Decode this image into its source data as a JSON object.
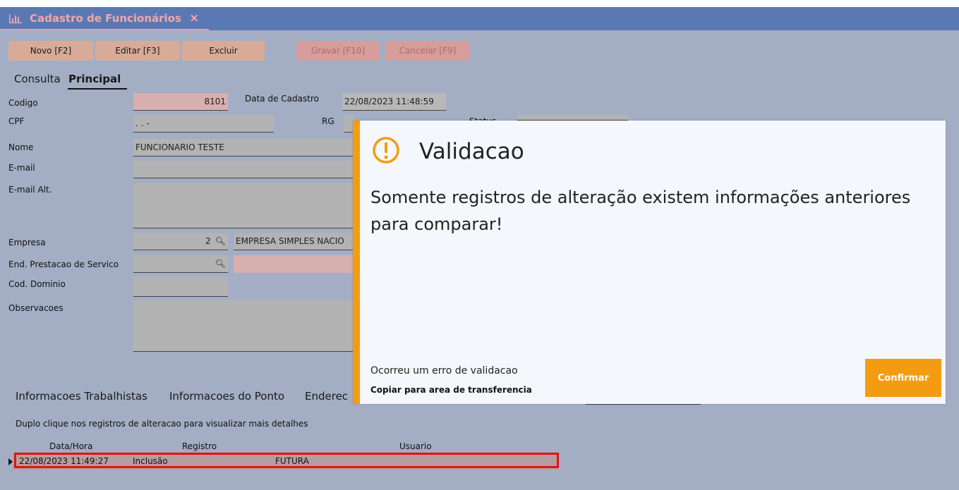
{
  "window": {
    "tab_title": "Cadastro de Funcionários",
    "close_glyph": "✕"
  },
  "toolbar": {
    "novo": "Novo [F2]",
    "editar": "Editar [F3]",
    "excluir": "Excluir",
    "gravar": "Gravar [F10]",
    "cancelar": "Cancelar [F9]"
  },
  "subtabs": {
    "consulta": "Consulta",
    "principal": "Principal"
  },
  "form": {
    "codigo_label": "Codigo",
    "codigo_value": "8101",
    "data_cadastro_label": "Data de Cadastro",
    "data_cadastro_value": "22/08/2023 11:48:59",
    "cpf_label": "CPF",
    "cpf_value": " .  .  -",
    "rg_label": "RG",
    "status_label": "Status",
    "nome_label": "Nome",
    "nome_value": "FUNCIONARIO TESTE",
    "email_label": "E-mail",
    "email_alt_label": "E-mail Alt.",
    "empresa_label": "Empresa",
    "empresa_code": "2",
    "empresa_name": "EMPRESA SIMPLES NACIO",
    "end_prest_label": "End. Prestacao de Servico",
    "cod_dominio_label": "Cod. Dominio",
    "observacoes_label": "Observacoes"
  },
  "bottom_tabs": [
    "Informacoes Trabalhistas",
    "Informacoes do Ponto",
    "Enderec"
  ],
  "history": {
    "hint": "Duplo clique nos registros de alteracao para visualizar mais detalhes",
    "columns": [
      "Data/Hora",
      "Registro",
      "Usuario"
    ],
    "rows": [
      {
        "datahora": "22/08/2023 11:49:27",
        "registro": "Inclusão",
        "usuario": "FUTURA"
      }
    ]
  },
  "dialog": {
    "title": "Validacao",
    "message": "Somente registros de alteração existem informações anteriores para comparar!",
    "error_text": "Ocorreu um erro de validacao",
    "copy_text": "Copiar para area de transferencia",
    "confirm_label": "Confirmar"
  },
  "colors": {
    "accent": "#f39c12",
    "titlebar": "#5a79b4",
    "background": "#a3aec4",
    "highlight": "#e21212"
  }
}
